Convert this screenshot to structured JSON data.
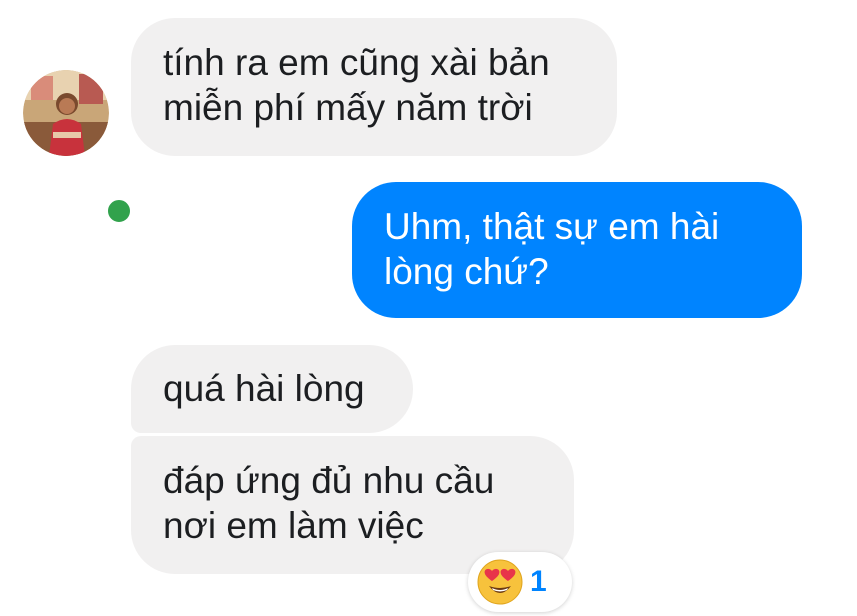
{
  "conversation": {
    "contact": {
      "status": "online",
      "status_color": "#31a24c"
    },
    "messages": [
      {
        "direction": "incoming",
        "text": "tính ra em cũng xài bản\nmiễn phí mấy năm trời"
      },
      {
        "direction": "outgoing",
        "text": "Uhm, thật sự em hài\nlòng chứ?"
      },
      {
        "direction": "incoming",
        "text": "quá hài lòng"
      },
      {
        "direction": "incoming",
        "text": "đáp ứng đủ nhu cầu\nnơi em làm việc"
      }
    ],
    "reaction": {
      "icon": "heart-eyes-emoji-icon",
      "count": "1"
    }
  },
  "colors": {
    "incoming_bubble": "#f1f0f0",
    "outgoing_bubble": "#0084ff",
    "reaction_count": "#0084ff"
  }
}
